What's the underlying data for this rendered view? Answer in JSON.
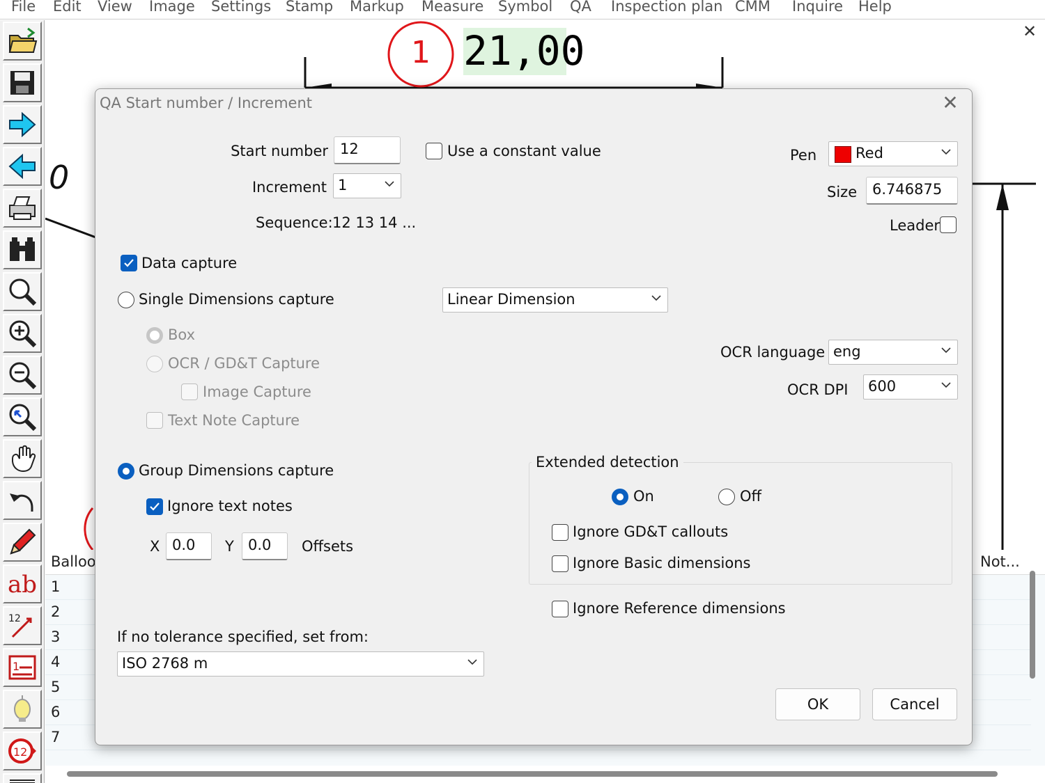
{
  "menu": [
    "File",
    "Edit",
    "View",
    "Image",
    "Settings",
    "Stamp",
    "Markup",
    "Measure",
    "Symbol",
    "QA",
    "Inspection plan",
    "CMM",
    "Inquire",
    "Help"
  ],
  "toolbar_icons": [
    "open-folder-icon",
    "save-icon",
    "forward-arrow-icon",
    "back-arrow-icon",
    "print-icon",
    "binoculars-icon",
    "zoom-icon",
    "zoom-in-icon",
    "zoom-out-icon",
    "zoom-previous-icon",
    "pan-hand-icon",
    "undo-icon",
    "pencil-icon",
    "text-ab-icon",
    "balloon-sequence-icon",
    "list-icon",
    "lightbulb-icon",
    "next-balloon-icon",
    "more-icon"
  ],
  "canvas": {
    "balloon_number": "1",
    "dimension_value": "21,00",
    "drawing_text": "0"
  },
  "table": {
    "headers": {
      "balloon": "Balloo",
      "notes": "Not..."
    },
    "rows": [
      "1",
      "2",
      "3",
      "4",
      "5",
      "6",
      "7"
    ]
  },
  "dialog": {
    "title": "QA Start number / Increment",
    "start_number_label": "Start number",
    "start_number_value": "12",
    "constant_value_label": "Use a constant value",
    "increment_label": "Increment",
    "increment_value": "1",
    "sequence_label": "Sequence:",
    "sequence_value": "12  13  14 ...",
    "pen_label": "Pen",
    "pen_value": "Red",
    "pen_color": "#ee0000",
    "size_label": "Size",
    "size_value": "6.746875",
    "leader_label": "Leader",
    "data_capture_label": "Data capture",
    "single_dim_label": "Single Dimensions capture",
    "dimension_type_value": "Linear Dimension",
    "box_label": "Box",
    "ocr_gdt_label": "OCR / GD&T Capture",
    "image_capture_label": "Image Capture",
    "text_note_label": "Text Note Capture",
    "ocr_language_label": "OCR language",
    "ocr_language_value": "eng",
    "ocr_dpi_label": "OCR DPI",
    "ocr_dpi_value": "600",
    "group_dim_label": "Group Dimensions capture",
    "ignore_text_notes_label": "Ignore text notes",
    "x_label": "X",
    "x_value": "0.0",
    "y_label": "Y",
    "y_value": "0.0",
    "offsets_label": "Offsets",
    "extended_detection_label": "Extended detection",
    "on_label": "On",
    "off_label": "Off",
    "ignore_gdt_label": "Ignore GD&T callouts",
    "ignore_basic_label": "Ignore Basic dimensions",
    "ignore_reference_label": "Ignore Reference dimensions",
    "tolerance_label": "If no tolerance specified, set from:",
    "tolerance_value": "ISO 2768 m",
    "ok_label": "OK",
    "cancel_label": "Cancel"
  },
  "colors": {
    "accent": "#0a5fc0",
    "balloon_red": "#e0161a",
    "dimension_highlight": "#dff4df"
  }
}
